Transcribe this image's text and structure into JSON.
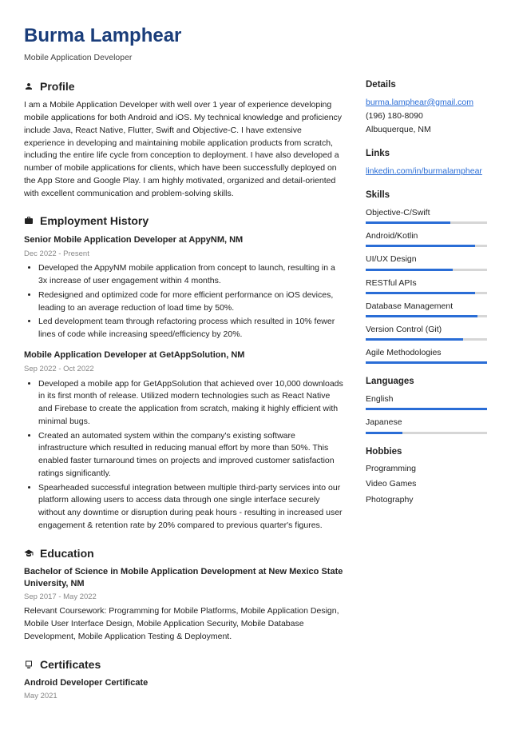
{
  "header": {
    "name": "Burma Lamphear",
    "role": "Mobile Application Developer"
  },
  "profile": {
    "title": "Profile",
    "text": "I am a Mobile Application Developer with well over 1 year of experience developing mobile applications for both Android and iOS. My technical knowledge and proficiency include Java, React Native, Flutter, Swift and Objective-C. I have extensive experience in developing and maintaining mobile application products from scratch, including the entire life cycle from conception to deployment. I have also developed a number of mobile applications for clients, which have been successfully deployed on the App Store and Google Play. I am highly motivated, organized and detail-oriented with excellent communication and problem-solving skills."
  },
  "employment": {
    "title": "Employment History",
    "jobs": [
      {
        "title": "Senior Mobile Application Developer at AppyNM, NM",
        "dates": "Dec 2022 - Present",
        "bullets": [
          "Developed the AppyNM mobile application from concept to launch, resulting in a 3x increase of user engagement within 4 months.",
          "Redesigned and optimized code for more efficient performance on iOS devices, leading to an average reduction of load time by 50%.",
          "Led development team through refactoring process which resulted in 10% fewer lines of code while increasing speed/efficiency by 20%."
        ]
      },
      {
        "title": "Mobile Application Developer at GetAppSolution, NM",
        "dates": "Sep 2022 - Oct 2022",
        "bullets": [
          "Developed a mobile app for GetAppSolution that achieved over 10,000 downloads in its first month of release. Utilized modern technologies such as React Native and Firebase to create the application from scratch, making it highly efficient with minimal bugs.",
          "Created an automated system within the company's existing software infrastructure which resulted in reducing manual effort by more than 50%. This enabled faster turnaround times on projects and improved customer satisfaction ratings significantly.",
          "Spearheaded successful integration between multiple third-party services into our platform allowing users to access data through one single interface securely without any downtime or disruption during peak hours - resulting in increased user engagement & retention rate by 20% compared to previous quarter's figures."
        ]
      }
    ]
  },
  "education": {
    "title": "Education",
    "degree": "Bachelor of Science in Mobile Application Development at New Mexico State University, NM",
    "dates": "Sep 2017 - May 2022",
    "text": "Relevant Coursework: Programming for Mobile Platforms, Mobile Application Design, Mobile User Interface Design, Mobile Application Security, Mobile Database Development, Mobile Application Testing & Deployment."
  },
  "certificates": {
    "title": "Certificates",
    "items": [
      {
        "name": "Android Developer Certificate",
        "date": "May 2021"
      }
    ]
  },
  "details": {
    "title": "Details",
    "email": "burma.lamphear@gmail.com",
    "phone": "(196) 180-8090",
    "location": "Albuquerque, NM"
  },
  "links": {
    "title": "Links",
    "items": [
      "linkedin.com/in/burmalamphear"
    ]
  },
  "skills": {
    "title": "Skills",
    "items": [
      {
        "name": "Objective-C/Swift",
        "pct": 70
      },
      {
        "name": "Android/Kotlin",
        "pct": 90
      },
      {
        "name": "UI/UX Design",
        "pct": 72
      },
      {
        "name": "RESTful APIs",
        "pct": 90
      },
      {
        "name": "Database Management",
        "pct": 92
      },
      {
        "name": "Version Control (Git)",
        "pct": 80
      },
      {
        "name": "Agile Methodologies",
        "pct": 100
      }
    ]
  },
  "languages": {
    "title": "Languages",
    "items": [
      {
        "name": "English",
        "pct": 100
      },
      {
        "name": "Japanese",
        "pct": 30
      }
    ]
  },
  "hobbies": {
    "title": "Hobbies",
    "items": [
      "Programming",
      "Video Games",
      "Photography"
    ]
  }
}
